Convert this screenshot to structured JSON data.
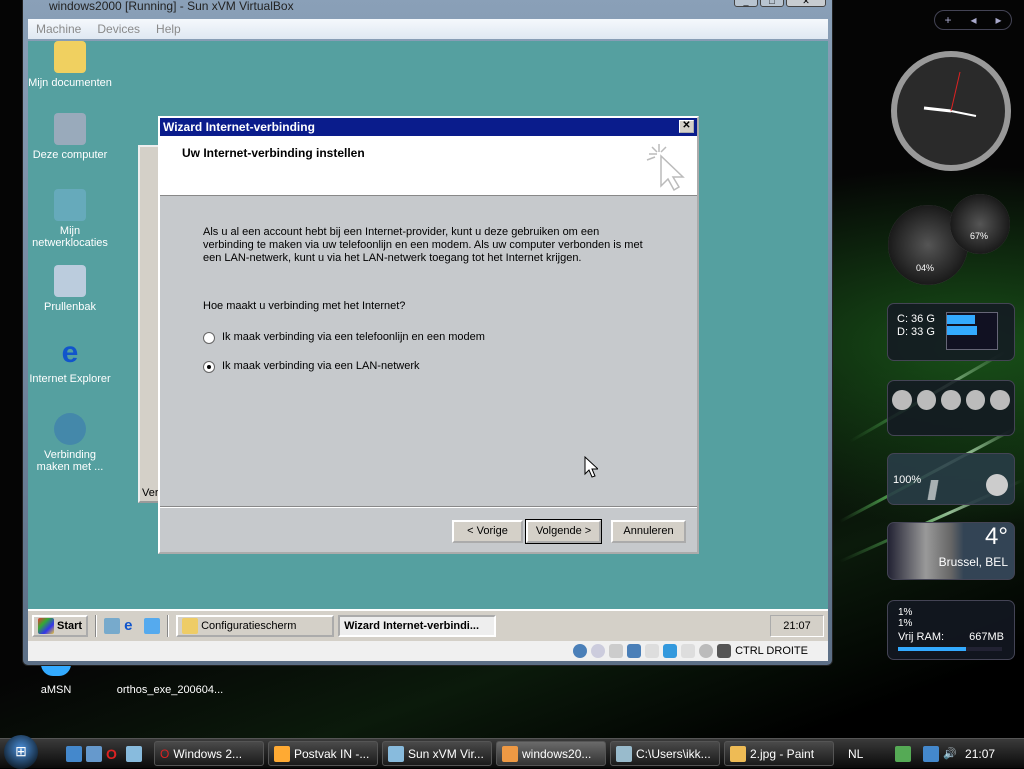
{
  "vm": {
    "title": "windows2000 [Running] - Sun xVM VirtualBox",
    "menu": [
      "Machine",
      "Devices",
      "Help"
    ],
    "status_key": "CTRL DROITE"
  },
  "guest_desktop": {
    "icons": [
      "Mijn documenten",
      "Deze computer",
      "Mijn netwerklocaties",
      "Prullenbak",
      "Internet Explorer",
      "Verbinding maken met ..."
    ]
  },
  "background_window": {
    "label": "Ver"
  },
  "wizard": {
    "title": "Wizard Internet-verbinding",
    "heading": "Uw Internet-verbinding instellen",
    "intro": "Als u al een account hebt bij een Internet-provider, kunt u deze gebruiken om een verbinding te maken via uw telefoonlijn en een modem. Als uw computer verbonden is met een LAN-netwerk, kunt u via het LAN-netwerk toegang tot het Internet krijgen.",
    "question": "Hoe maakt u verbinding met het Internet?",
    "options": [
      {
        "label": "Ik maak verbinding via een telefoonlijn en een modem",
        "selected": false
      },
      {
        "label": "Ik maak verbinding via een LAN-netwerk",
        "selected": true
      }
    ],
    "buttons": {
      "back": "< Vorige",
      "next": "Volgende >",
      "cancel": "Annuleren"
    }
  },
  "guest_taskbar": {
    "start": "Start",
    "tasks": [
      "Configuratiescherm",
      "Wizard Internet-verbindi..."
    ],
    "clock": "21:07"
  },
  "host_desktop": {
    "icons": [
      "aMSN",
      "orthos_exe_200604..."
    ]
  },
  "gadgets": {
    "cpu": "04%",
    "mem": "67%",
    "drives": [
      {
        "label": "C: 36 G",
        "fill": 0.55
      },
      {
        "label": "D: 33 G",
        "fill": 0.6
      }
    ],
    "volume": "100%",
    "weather": {
      "temp": "4°",
      "city": "Brussel, BEL"
    },
    "cpu1": "1%",
    "cpu2": "1%",
    "ram_label": "Vrij RAM:",
    "ram_value": "667MB",
    "ram_fill": 0.65
  },
  "taskbar": {
    "tasks": [
      "Windows 2...",
      "Postvak IN -...",
      "Sun xVM Vir...",
      "windows20...",
      "C:\\Users\\ikk...",
      "2.jpg - Paint"
    ],
    "lang": "NL",
    "clock": "21:07"
  }
}
